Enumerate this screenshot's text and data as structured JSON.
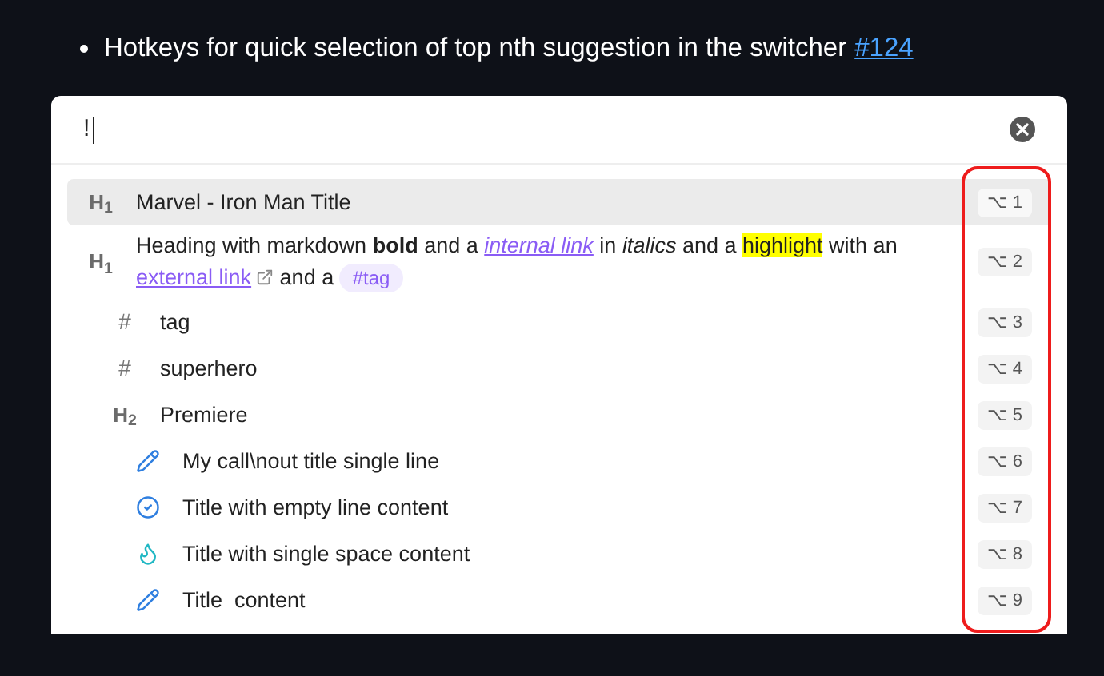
{
  "bullet": {
    "text": "Hotkeys for quick selection of top nth suggestion in the switcher",
    "link": "#124"
  },
  "search": {
    "value": "!"
  },
  "results": [
    {
      "kind": "heading",
      "marker": "H$_{1}$",
      "title": "Marvel - Iron Man Title",
      "hotkey": "⌥ 1",
      "selected": true
    },
    {
      "kind": "heading",
      "marker": "H$_{1}$",
      "segments": [
        {
          "kind": "text",
          "text": "Heading with markdown "
        },
        {
          "kind": "bold",
          "text": "bold"
        },
        {
          "kind": "text",
          "text": " and a "
        },
        {
          "kind": "internal-link",
          "text": "internal link"
        },
        {
          "kind": "text",
          "text": " in "
        },
        {
          "kind": "italic",
          "text": "italics"
        },
        {
          "kind": "text",
          "text": " and a "
        },
        {
          "kind": "highlight",
          "text": "highlight"
        },
        {
          "kind": "text",
          "text": " with an "
        },
        {
          "kind": "external-link",
          "text": "external link"
        },
        {
          "kind": "text",
          "text": " and a "
        },
        {
          "kind": "tag",
          "text": "#tag"
        }
      ],
      "hotkey": "⌥ 2",
      "selected": false,
      "children": [
        {
          "kind": "tag",
          "marker": "#",
          "title": "tag",
          "hotkey": "⌥ 3",
          "selected": false
        },
        {
          "kind": "tag",
          "marker": "#",
          "title": "superhero",
          "hotkey": "⌥ 4",
          "selected": false
        },
        {
          "kind": "heading",
          "marker": "H$_{2}$",
          "title": "Premiere",
          "hotkey": "⌥ 5",
          "selected": false,
          "children": [
            {
              "kind": "note",
              "title": "My call\\nout title single line",
              "hotkey": "⌥ 6",
              "selected": false
            },
            {
              "kind": "success",
              "title": "Title with empty line content",
              "hotkey": "⌥ 7",
              "selected": false
            },
            {
              "kind": "tip",
              "title": "Title with single space content",
              "hotkey": "⌥ 8",
              "selected": false
            },
            {
              "kind": "note",
              "title": "Title  content",
              "hotkey": "⌥ 9",
              "selected": false
            }
          ]
        }
      ]
    }
  ]
}
